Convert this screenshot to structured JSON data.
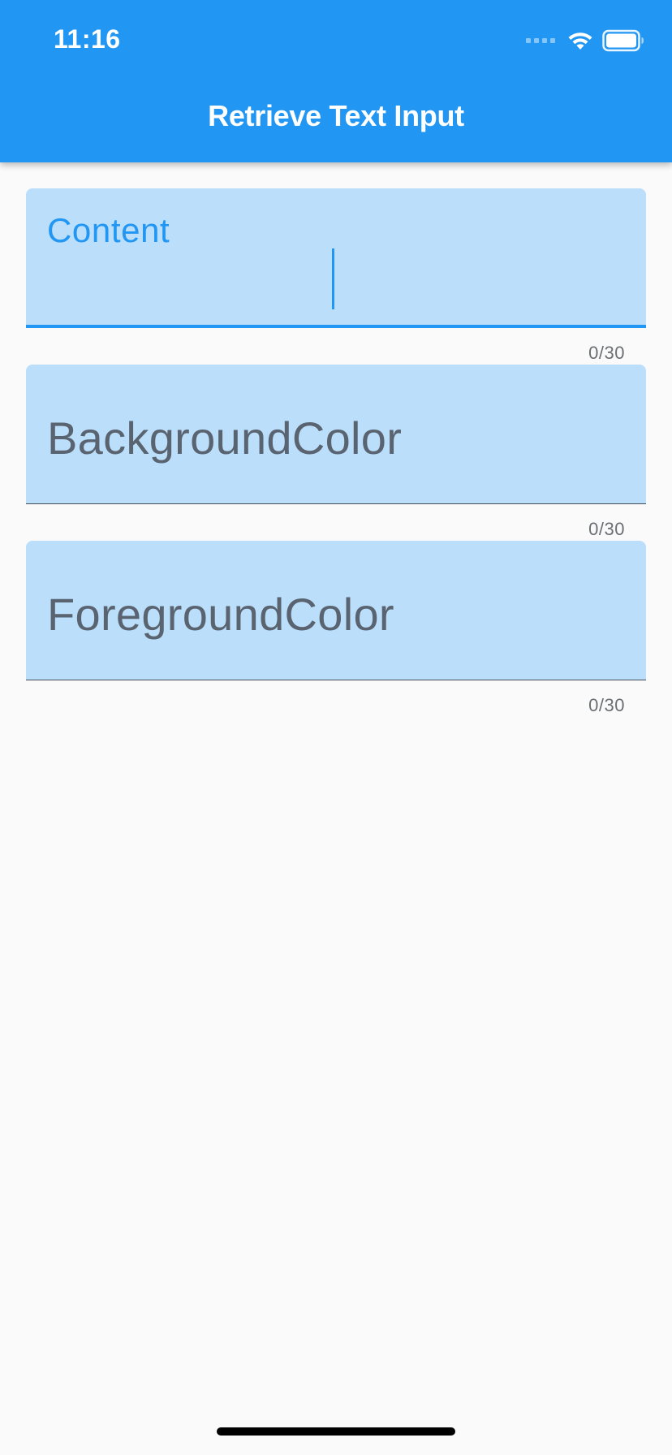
{
  "status_bar": {
    "time": "11:16",
    "wifi_icon": "wifi-icon",
    "battery_icon": "battery-icon",
    "signal_icon": "signal-icon"
  },
  "appbar": {
    "title": "Retrieve Text Input",
    "color": "#2196f3"
  },
  "fields": [
    {
      "label": "Content",
      "value": "",
      "counter": "0/30",
      "focused": true
    },
    {
      "label": "BackgroundColor",
      "value": "",
      "counter": "0/30",
      "focused": false
    },
    {
      "label": "ForegroundColor",
      "value": "",
      "counter": "0/30",
      "focused": false
    }
  ],
  "colors": {
    "field_fill": "#bbdefb",
    "accent": "#2196f3",
    "background": "#fafafa"
  }
}
